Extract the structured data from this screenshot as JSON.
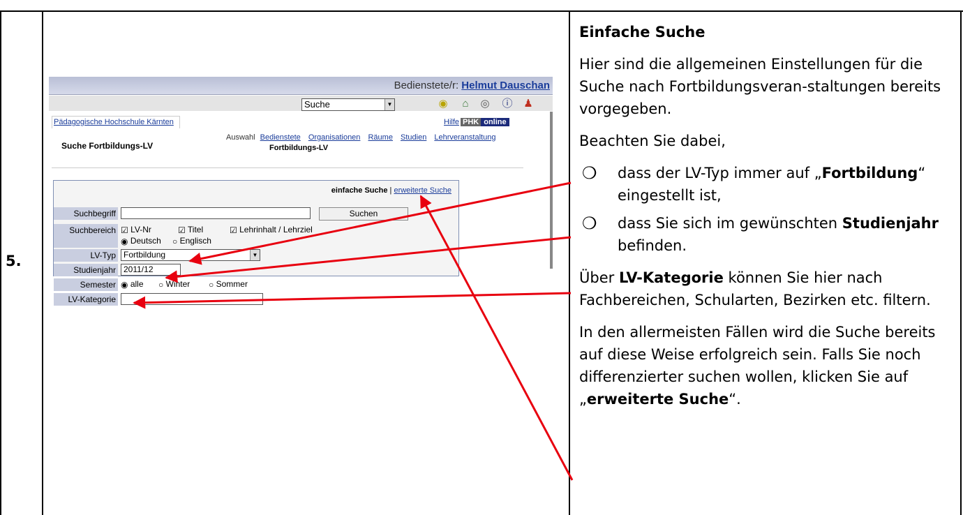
{
  "step": {
    "number": "5."
  },
  "screenshot": {
    "staff_label": "Bedienstete/r:",
    "staff_name": "Helmut Dauschan",
    "nav_select": "Suche",
    "org_name": "Pädagogische Hochschule Kärnten",
    "help": "Hilfe",
    "logo_phk": "PHK",
    "logo_online": "online",
    "page_title": "Suche Fortbildungs-LV",
    "nav_label": "Auswahl",
    "nav_links": [
      "Bedienstete",
      "Organisationen",
      "Räume",
      "Studien",
      "Lehrveranstaltung"
    ],
    "nav_sub": "Fortbildungs-LV",
    "mode_simple": "einfache Suche",
    "mode_separator": "|",
    "mode_advanced": "erweiterte Suche",
    "form": {
      "search_term_label": "Suchbegriff",
      "search_term_value": "",
      "search_button": "Suchen",
      "search_area_label": "Suchbereich",
      "search_area_options": [
        "LV-Nr",
        "Titel",
        "Lehrinhalt / Lehrziel"
      ],
      "language_options": [
        "Deutsch",
        "Englisch"
      ],
      "lv_type_label": "LV-Typ",
      "lv_type_value": "Fortbildung",
      "study_year_label": "Studienjahr",
      "study_year_value": "2011/12",
      "semester_label": "Semester",
      "semester_options": [
        "alle",
        "Winter",
        "Sommer"
      ],
      "lv_category_label": "LV-Kategorie",
      "lv_category_value": ""
    }
  },
  "explanation": {
    "heading": "Einfache Suche",
    "para1": "Hier sind die allgemeinen Einstellungen für die Suche nach Fortbildungsveran-staltungen bereits vorgegeben.",
    "para2": "Beachten Sie dabei,",
    "bullet_symbol": "❍",
    "bullet1_pre": "dass der LV-Typ immer auf „",
    "bullet1_bold": "Fortbildung",
    "bullet1_post": "“ eingestellt ist,",
    "bullet2_pre": "dass Sie sich im gewünschten ",
    "bullet2_bold": "Studienjahr",
    "bullet2_post": " befinden.",
    "para3_pre": "Über ",
    "para3_bold": "LV-Kategorie",
    "para3_post": " können Sie hier nach Fachbereichen, Schularten, Bezirken etc. filtern.",
    "para4_pre": "In den allermeisten Fällen wird die Suche bereits auf diese Weise erfolgreich sein. Falls Sie noch differenzierter suchen wollen, klicken Sie auf „",
    "para4_bold": "erweiterte Suche",
    "para4_post": "“."
  },
  "colors": {
    "arrow": "#e8000f",
    "link": "#1a3c9a",
    "header": "#c9cee0"
  }
}
